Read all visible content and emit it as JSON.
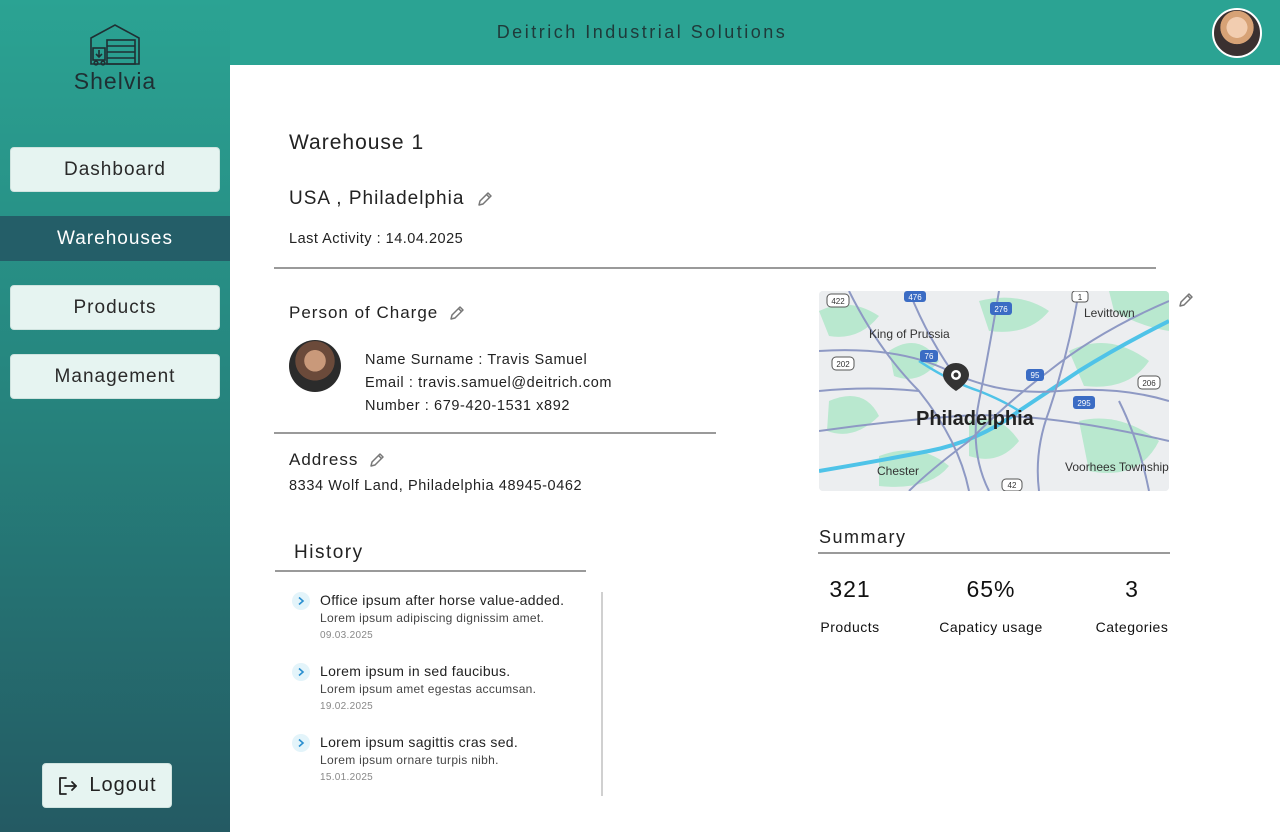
{
  "brand": {
    "name": "Shelvia",
    "icon": "warehouse-icon"
  },
  "sidebar": {
    "items": [
      {
        "label": "Dashboard"
      },
      {
        "label": "Warehouses",
        "active": true
      },
      {
        "label": "Products"
      },
      {
        "label": "Management"
      }
    ],
    "logout": {
      "label": "Logout",
      "icon": "logout-icon"
    }
  },
  "header": {
    "company": "Deitrich Industrial Solutions"
  },
  "warehouse": {
    "title": "Warehouse 1",
    "location": "USA , Philadelphia",
    "last_activity": "Last Activity : 14.04.2025"
  },
  "person": {
    "section_label": "Person of Charge",
    "name_line": "Name Surname : Travis Samuel",
    "email_line": "Email : travis.samuel@deitrich.com",
    "number_line": "Number : 679-420-1531 x892"
  },
  "address": {
    "section_label": "Address",
    "text": "8334 Wolf Land, Philadelphia 48945-0462"
  },
  "history": {
    "title": "History",
    "items": [
      {
        "title": "Office ipsum after horse value-added.",
        "subtitle": "Lorem ipsum adipiscing dignissim amet.",
        "date": "09.03.2025"
      },
      {
        "title": "Lorem ipsum in sed faucibus.",
        "subtitle": "Lorem ipsum amet egestas accumsan.",
        "date": "19.02.2025"
      },
      {
        "title": "Lorem ipsum sagittis cras sed.",
        "subtitle": "Lorem ipsum ornare turpis nibh.",
        "date": "15.01.2025"
      }
    ]
  },
  "map": {
    "city_label": "Philadelphia",
    "places": [
      "King of Prussia",
      "Levittown",
      "Chester",
      "Voorhees Township"
    ],
    "shields": [
      "422",
      "476",
      "276",
      "1",
      "202",
      "76",
      "95",
      "206",
      "295",
      "42"
    ]
  },
  "summary": {
    "title": "Summary",
    "stats": [
      {
        "value": "321",
        "label": "Products"
      },
      {
        "value": "65%",
        "label": "Capaticy usage"
      },
      {
        "value": "3",
        "label": "Categories"
      }
    ]
  },
  "colors": {
    "header_bg": "#2ba393",
    "sidebar_top": "#2ba393",
    "sidebar_bottom": "#245a63",
    "active_nav": "#245e68",
    "button_bg": "#e6f4f1"
  }
}
